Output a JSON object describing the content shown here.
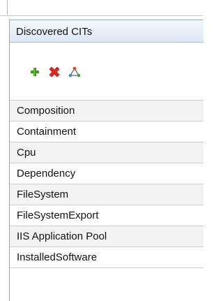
{
  "panel": {
    "title": "Discovered CITs"
  },
  "toolbar": {
    "buttons": [
      {
        "icon": "add-icon",
        "color": "#3a9a1c"
      },
      {
        "icon": "delete-icon",
        "color": "#e0281b"
      },
      {
        "icon": "relations-icon",
        "color": "#d14a1c"
      }
    ]
  },
  "list": {
    "items": [
      "Composition",
      "Containment",
      "Cpu",
      "Dependency",
      "FileSystem",
      "FileSystemExport",
      "IIS Application Pool",
      "InstalledSoftware"
    ]
  }
}
